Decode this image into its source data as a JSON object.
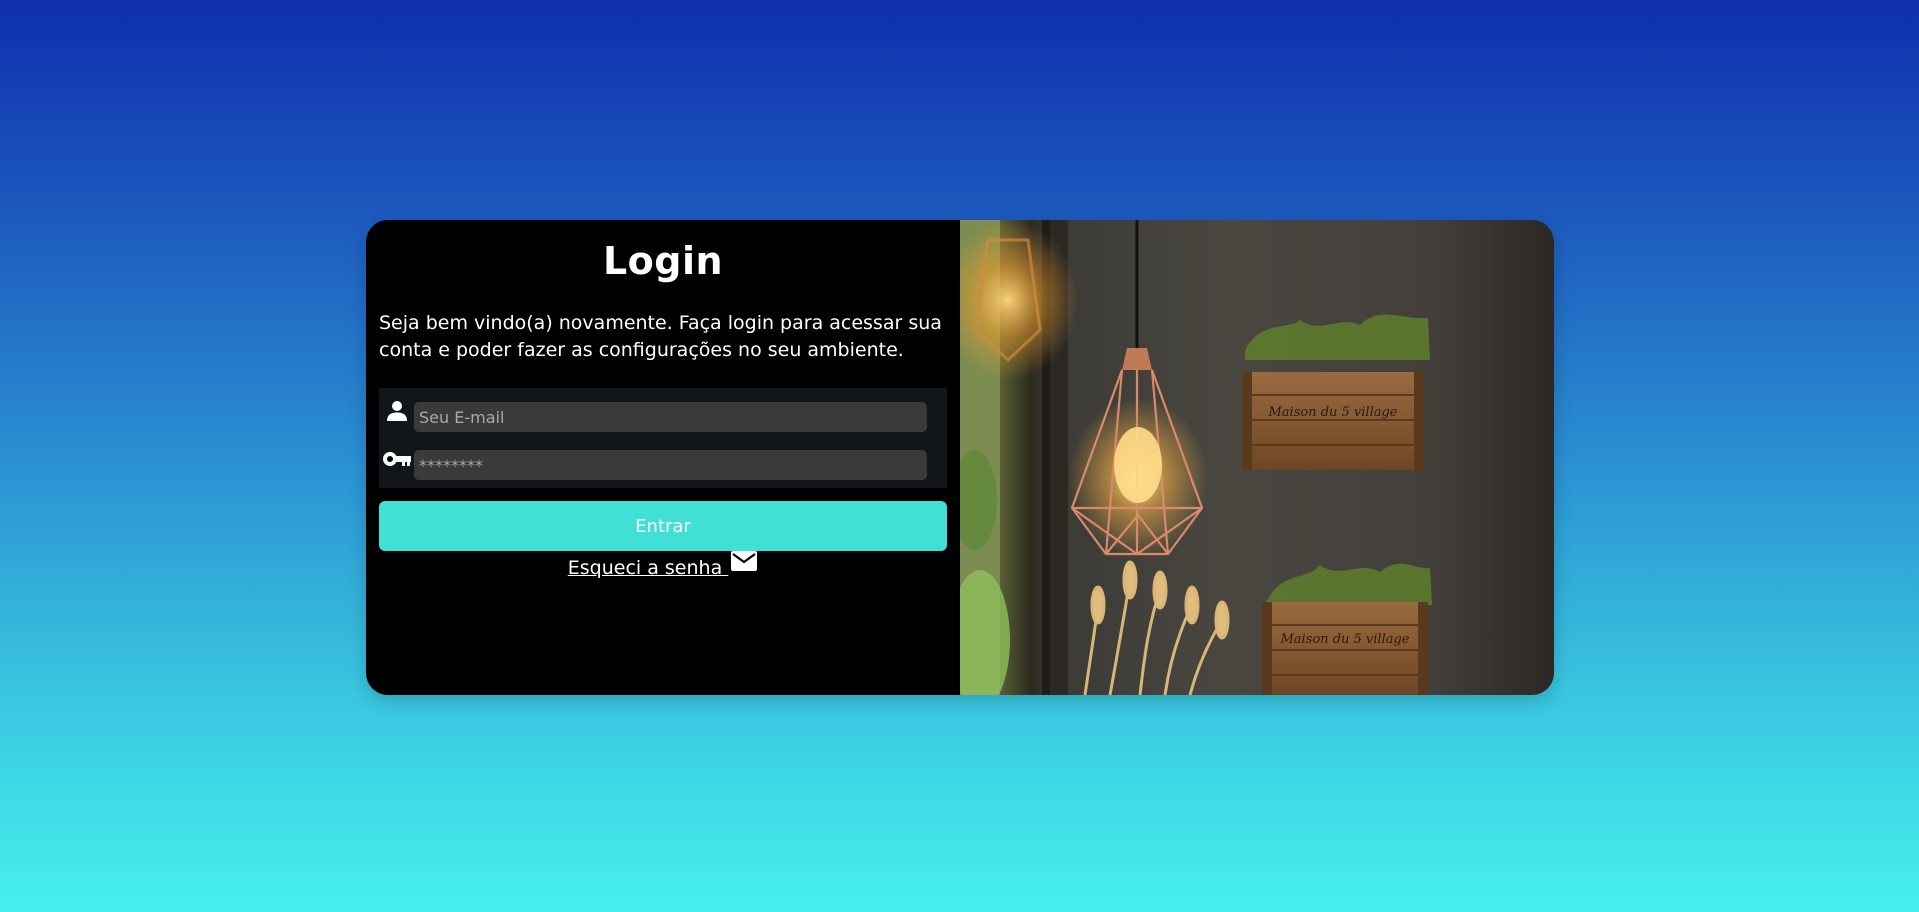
{
  "login": {
    "title": "Login",
    "welcome": "Seja bem vindo(a) novamente. Faça login para acessar sua conta e poder fazer as configurações no seu ambiente.",
    "email_placeholder": "Seu E-mail",
    "password_placeholder": "********",
    "submit_label": "Entrar",
    "forgot_label": "Esqueci a senha ",
    "icons": {
      "email_field": "person-icon",
      "password_field": "key-icon",
      "forgot": "mail-icon"
    }
  },
  "colors": {
    "button": "#40e0d6",
    "panel": "#000000",
    "fields_background": "#11161b",
    "input_background": "#3a3a3a",
    "gradient_top": "#0f2fae",
    "gradient_bottom": "#47f0ee"
  }
}
